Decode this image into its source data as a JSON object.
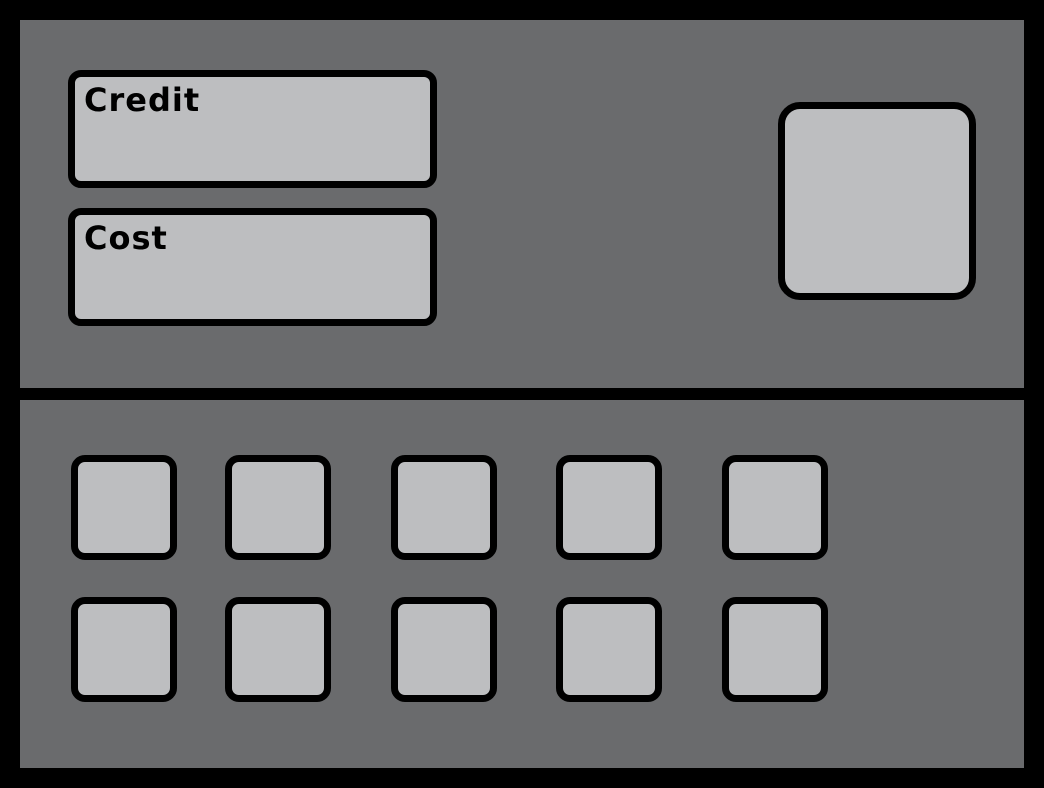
{
  "shop": {
    "credit_label": "Credit",
    "cost_label": "Cost"
  }
}
